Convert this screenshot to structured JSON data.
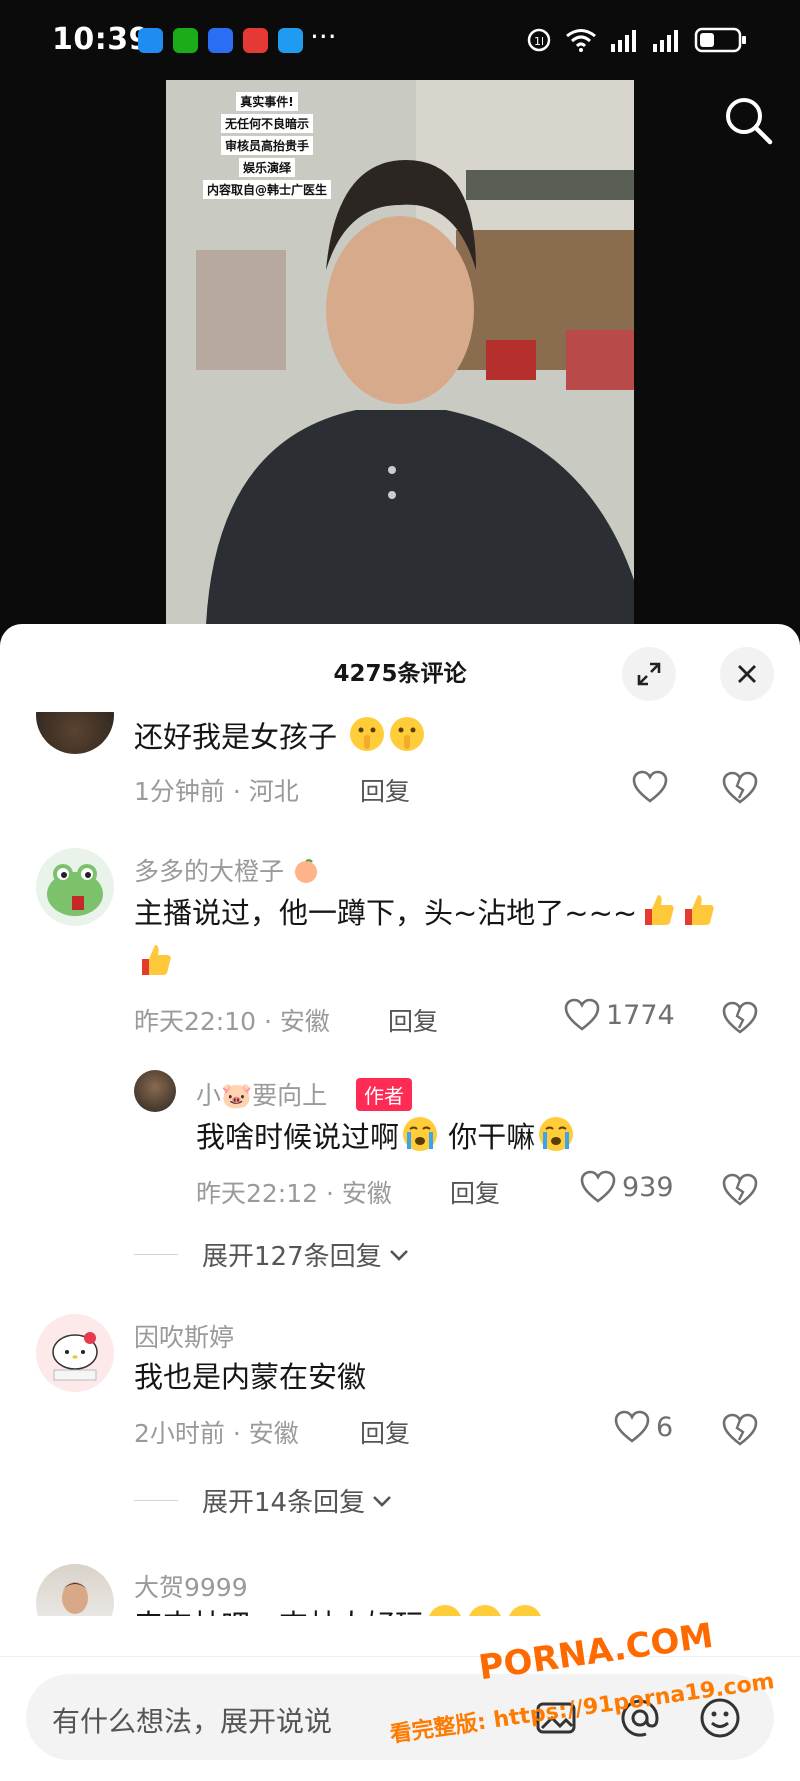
{
  "status_bar": {
    "time": "10:39"
  },
  "video": {
    "overlay_lines": [
      "真实事件!",
      "无任何不良暗示",
      "审核员高抬贵手",
      "娱乐演绎",
      "内容取自@韩士广医生"
    ]
  },
  "comments_panel": {
    "title": "4275条评论",
    "comments": [
      {
        "text": "还好我是女孩子",
        "meta": "1分钟前 · 河北",
        "reply": "回复"
      },
      {
        "username": "多多的大橙子",
        "text_line1": "主播说过，他一蹲下，头~沾地了~~~",
        "meta": "昨天22:10 · 安徽",
        "reply": "回复",
        "likes": "1774",
        "sub_reply": {
          "username": "小🐷要向上",
          "badge": "作者",
          "text_a": "我啥时候说过啊",
          "text_b": " 你干嘛",
          "meta": "昨天22:12 · 安徽",
          "reply": "回复",
          "likes": "939"
        },
        "expand": "展开127条回复"
      },
      {
        "username": "因吹斯婷",
        "text": "我也是内蒙在安徽",
        "meta": "2小时前 · 安徽",
        "reply": "回复",
        "likes": "6",
        "expand": "展开14条回复"
      },
      {
        "username": "大贺9999",
        "text": "来吉林吧，吉林人好玩"
      }
    ]
  },
  "input_bar": {
    "placeholder": "有什么想法，展开说说"
  },
  "watermark": {
    "line1": "PORNA.COM",
    "line2": "看完整版: https://91porna19.com"
  }
}
